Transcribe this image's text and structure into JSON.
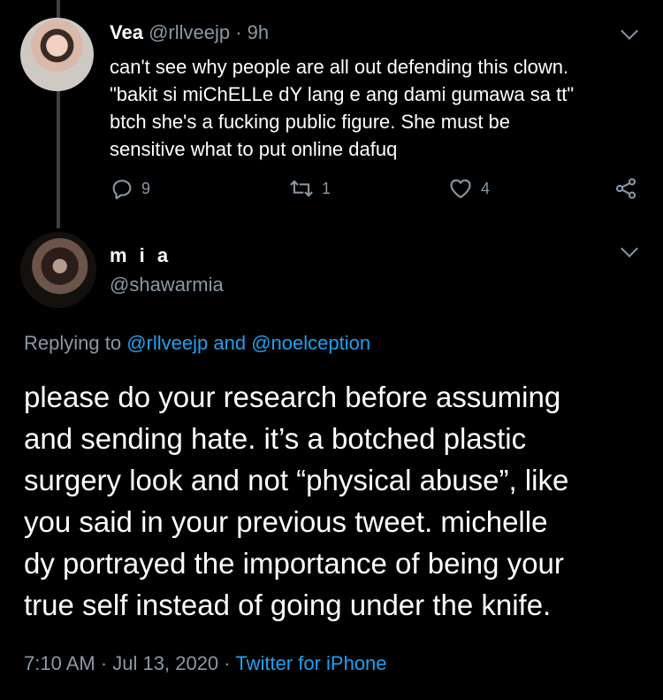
{
  "reply_to_tweet": {
    "display_name": "Vea",
    "handle": "@rllveejp",
    "separator": "·",
    "time_ago": "9h",
    "text_lines": [
      "can't see why people are all out defending this clown.",
      "\"bakit si miChELLe dY lang e ang dami gumawa sa tt\"",
      "btch she's a fucking public figure. She must be",
      "sensitive what to put online dafuq"
    ],
    "reply_count": "9",
    "retweet_count": "1",
    "like_count": "4"
  },
  "main_tweet": {
    "display_name": "m i a",
    "handle": "@shawarmia",
    "replying_prefix": "Replying to",
    "replying_user_1": "@rllveejp",
    "replying_and": "and",
    "replying_user_2": "@noelception",
    "text_lines": [
      "please do your research before assuming",
      "and sending hate. it’s a botched plastic",
      "surgery look and not “physical abuse”, like",
      "you said in your previous tweet. michelle",
      "dy portrayed the importance of being your",
      "true self instead of going under the knife."
    ],
    "time": "7:10 AM",
    "separator": "·",
    "date": "Jul 13, 2020",
    "separator2": "·",
    "source": "Twitter for iPhone"
  },
  "icons": {
    "reply": "reply-icon",
    "retweet": "retweet-icon",
    "like": "heart-icon",
    "share": "share-icon",
    "more": "chevron-down-icon"
  },
  "colors": {
    "background": "#000000",
    "text": "#ffffff",
    "muted": "#8b98a5",
    "link": "#1da1f2",
    "thread_line": "#3d4147"
  }
}
